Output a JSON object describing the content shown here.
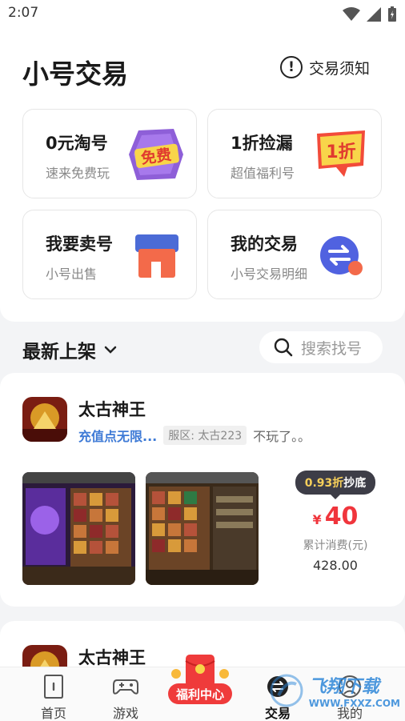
{
  "status_bar": {
    "time": "2:07"
  },
  "header": {
    "title": "小号交易",
    "notice_label": "交易须知",
    "notice_icon": "exclamation-circle-icon"
  },
  "tiles": [
    {
      "title": "0元淘号",
      "subtitle": "速来免费玩",
      "art_text": "免费",
      "icon": "free-badge-icon"
    },
    {
      "title": "1折捡漏",
      "subtitle": "超值福利号",
      "art_text": "1折",
      "icon": "discount-badge-icon"
    },
    {
      "title": "我要卖号",
      "subtitle": "小号出售",
      "icon": "shop-icon"
    },
    {
      "title": "我的交易",
      "subtitle": "小号交易明细",
      "icon": "swap-icon"
    }
  ],
  "filter": {
    "sort_label": "最新上架",
    "search_placeholder": "搜索找号"
  },
  "listings": [
    {
      "game_name": "太古神王",
      "title": "充值点无限...",
      "server": "服区: 太古223",
      "note": "不玩了。。",
      "discount_value": "0.93折",
      "discount_suffix": "抄底",
      "currency": "¥",
      "price": "40",
      "spent_label": "累计消费(元)",
      "spent_value": "428.00"
    },
    {
      "game_name": "太古神王"
    }
  ],
  "tabbar": {
    "items": [
      {
        "label": "首页",
        "icon": "home-icon"
      },
      {
        "label": "游戏",
        "icon": "gamepad-icon"
      },
      {
        "label": "福利中心",
        "icon": "red-envelope-icon"
      },
      {
        "label": "交易",
        "icon": "trade-icon"
      },
      {
        "label": "我的",
        "icon": "profile-icon"
      }
    ]
  },
  "watermark": {
    "text": "飞翔下载",
    "url": "WWW.FXXZ.COM"
  },
  "colors": {
    "accent": "#f0353c",
    "link": "#3e7ad6",
    "badge_bg": "#3d3d47",
    "welfare": "#ef3b3b"
  }
}
